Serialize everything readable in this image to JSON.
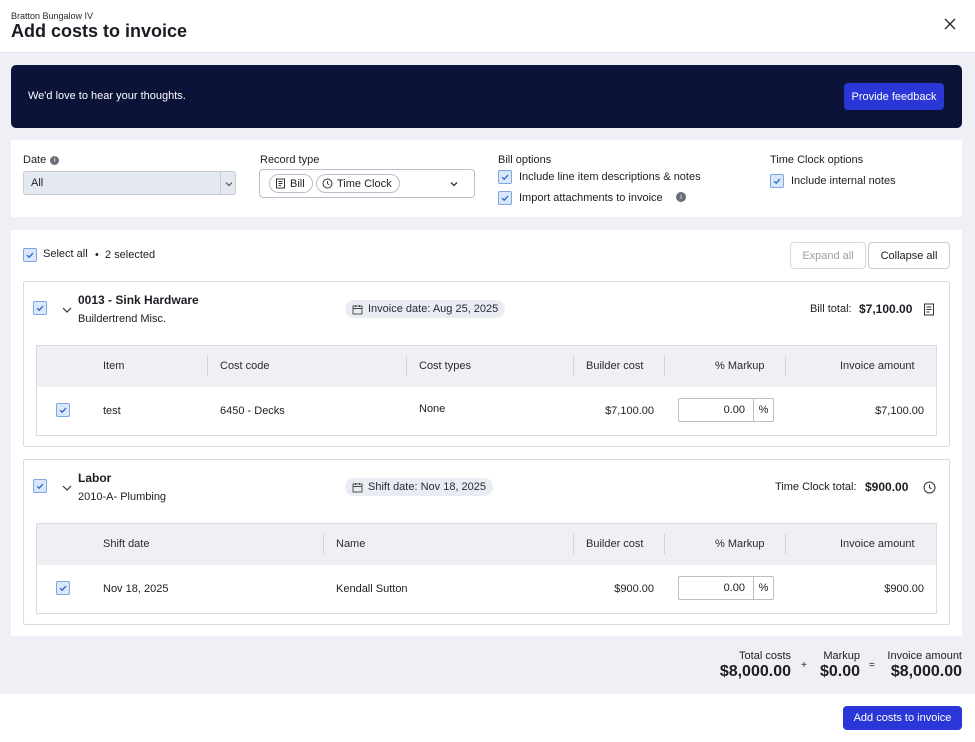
{
  "header": {
    "project": "Bratton Bungalow IV",
    "title": "Add costs to invoice"
  },
  "banner": {
    "text": "We'd love to hear your thoughts.",
    "button": "Provide feedback"
  },
  "filters": {
    "date_label": "Date",
    "date_value": "All",
    "record_type_label": "Record type",
    "record_types": [
      "Bill",
      "Time Clock"
    ],
    "bill_options_label": "Bill options",
    "bill_option_1": "Include line item descriptions & notes",
    "bill_option_2": "Import attachments to invoice",
    "time_clock_options_label": "Time Clock options",
    "time_clock_option_1": "Include internal notes"
  },
  "toolbar": {
    "select_all": "Select all",
    "dot": "•",
    "selected_count": "2 selected",
    "expand_all": "Expand all",
    "collapse_all": "Collapse all"
  },
  "bill": {
    "title": "0013 - Sink Hardware",
    "subtitle": "Buildertrend Misc.",
    "date_tag": "Invoice date: Aug 25, 2025",
    "total_label": "Bill total:",
    "total_value": "$7,100.00",
    "columns": [
      "Item",
      "Cost code",
      "Cost types",
      "Builder cost",
      "% Markup",
      "Invoice amount"
    ],
    "row": {
      "item": "test",
      "cost_code": "6450 - Decks",
      "cost_types": "None",
      "builder_cost": "$7,100.00",
      "markup": "0.00",
      "pct": "%",
      "invoice_amount": "$7,100.00"
    }
  },
  "labor": {
    "title": "Labor",
    "subtitle": "2010-A- Plumbing",
    "date_tag": "Shift date: Nov 18, 2025",
    "total_label": "Time Clock total:",
    "total_value": "$900.00",
    "columns": [
      "Shift date",
      "Name",
      "Builder cost",
      "% Markup",
      "Invoice amount"
    ],
    "row": {
      "shift_date": "Nov 18, 2025",
      "name": "Kendall Sutton",
      "builder_cost": "$900.00",
      "markup": "0.00",
      "pct": "%",
      "invoice_amount": "$900.00"
    }
  },
  "totals": {
    "total_costs_label": "Total costs",
    "total_costs_value": "$8,000.00",
    "plus": "+",
    "markup_label": "Markup",
    "markup_value": "$0.00",
    "equals": "=",
    "invoice_amount_label": "Invoice amount",
    "invoice_amount_value": "$8,000.00"
  },
  "footer": {
    "add_button": "Add costs to invoice"
  },
  "colors": {
    "primary": "#2a37d6",
    "banner_bg": "#0b1338",
    "checkbox": "#d9e7fb"
  }
}
